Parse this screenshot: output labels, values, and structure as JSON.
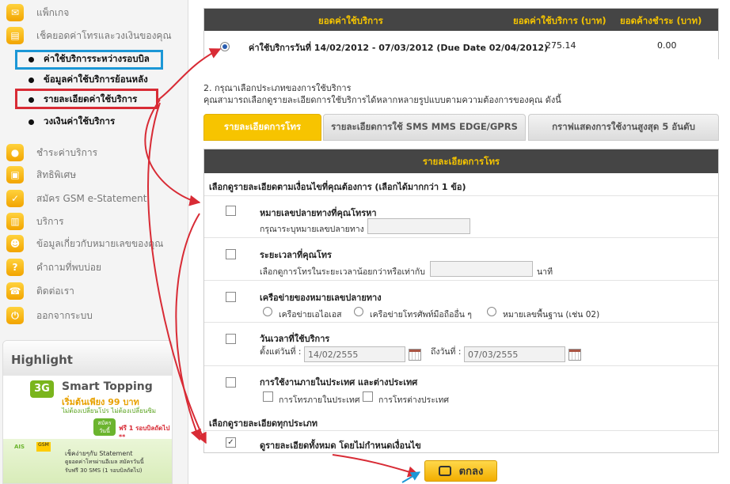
{
  "sidebar": {
    "menu": [
      {
        "label": "แพ็กเกจ",
        "icon": "package-icon"
      },
      {
        "label": "เช็คยอดค่าโทรและวงเงินของคุณ",
        "icon": "check-balance-icon"
      },
      {
        "label": "ชำระค่าบริการ",
        "icon": "payment-icon"
      },
      {
        "label": "สิทธิพิเศษ",
        "icon": "privilege-icon"
      },
      {
        "label": "สมัคร GSM e-Statement",
        "icon": "e-statement-icon"
      },
      {
        "label": "บริการ",
        "icon": "service-icon"
      },
      {
        "label": "ข้อมูลเกี่ยวกับหมายเลขของคุณ",
        "icon": "number-info-icon"
      },
      {
        "label": "คำถามที่พบบ่อย",
        "icon": "faq-icon"
      },
      {
        "label": "ติดต่อเรา",
        "icon": "contact-icon"
      },
      {
        "label": "ออกจากระบบ",
        "icon": "logout-icon"
      }
    ],
    "submenu": [
      {
        "label": "ค่าใช้บริการระหว่างรอบบิล"
      },
      {
        "label": "ข้อมูลค่าใช้บริการย้อนหลัง"
      },
      {
        "label": "รายละเอียดค่าใช้บริการ"
      },
      {
        "label": "วงเงินค่าใช้บริการ"
      }
    ],
    "highlight": {
      "title": "Highlight",
      "banner1": {
        "badge": "3G",
        "title": "Smart Topping",
        "price": "เริ่มต้นเพียง 99 บาท",
        "note": "ไม่ต้องเปลี่ยนโปร ไม่ต้องเปลี่ยนซิม",
        "button": "สมัคร วันนี้",
        "free": "ฟรี 1 รอบบิลถัดไป **"
      },
      "banner2": {
        "logo": "AIS",
        "logo2": "GSM",
        "line1": "เช็คง่ายๆกับ Statement",
        "line2": "ดูยอดค่าโทรผ่านอีเมล สมัครวันนี้",
        "line3": "รับฟรี 30 SMS (1 รอบบิลถัดไป)"
      }
    }
  },
  "summary": {
    "headers": [
      "ยอดค่าใช้บริการ",
      "ยอดค่าใช้บริการ (บาท)",
      "ยอดค้างชำระ (บาท)"
    ],
    "row": {
      "description": "ค่าใช้บริการวันที่ 14/02/2012 - 07/03/2012 (Due Date 02/04/2012)",
      "amount": "275.14",
      "outstanding": "0.00"
    }
  },
  "intro": {
    "line1": "2. กรุณาเลือกประเภทของการใช้บริการ",
    "line2": "คุณสามารถเลือกดูรายละเอียดการใช้บริการได้หลากหลายรูปแบบตามความต้องการของคุณ ดังนี้"
  },
  "tabs": [
    "รายละเอียดการโทร",
    "รายละเอียดการใช้ SMS MMS EDGE/GPRS",
    "กราฟแสดงการใช้งานสูงสุด 5 อันดับ"
  ],
  "detail": {
    "header": "รายละเอียดการโทร",
    "section1": "เลือกดูรายละเอียดตามเงื่อนไขที่คุณต้องการ (เลือกได้มากกว่า 1 ข้อ)",
    "opt1": {
      "title": "หมายเลขปลายทางที่คุณโทรหา",
      "sub": "กรุณาระบุหมายเลขปลายทาง"
    },
    "opt2": {
      "title": "ระยะเวลาที่คุณโทร",
      "sub": "เลือกดูการโทรในระยะเวลาน้อยกว่าหรือเท่ากับ",
      "unit": "นาที"
    },
    "opt3": {
      "title": "เครือข่ายของหมายเลขปลายทาง",
      "choices": [
        "เครือข่ายเอไอเอส",
        "เครือข่ายโทรศัพท์มือถืออื่น ๆ",
        "หมายเลขพื้นฐาน (เช่น 02)"
      ]
    },
    "opt4": {
      "title": "วันเวลาที่ใช้บริการ",
      "from_label": "ตั้งแต่วันที่ :",
      "from_value": "14/02/2555",
      "to_label": "ถึงวันที่ :",
      "to_value": "07/03/2555"
    },
    "opt5": {
      "title": "การใช้งานภายในประเทศ และต่างประเทศ",
      "choices": [
        "การโทรภายในประเทศ",
        "การโทรต่างประเทศ"
      ]
    },
    "section2": "เลือกดูรายละเอียดทุกประเภท",
    "all": {
      "title": "ดูรายละเอียดทั้งหมด โดยไม่กำหนดเงื่อนไข",
      "checked": true
    }
  },
  "ok_button": "ตกลง",
  "colors": {
    "accent": "#f7c400",
    "header_bg": "#454545",
    "header_text": "#f5c400",
    "annotation_red": "#d82b35",
    "annotation_blue": "#1c97d6"
  }
}
